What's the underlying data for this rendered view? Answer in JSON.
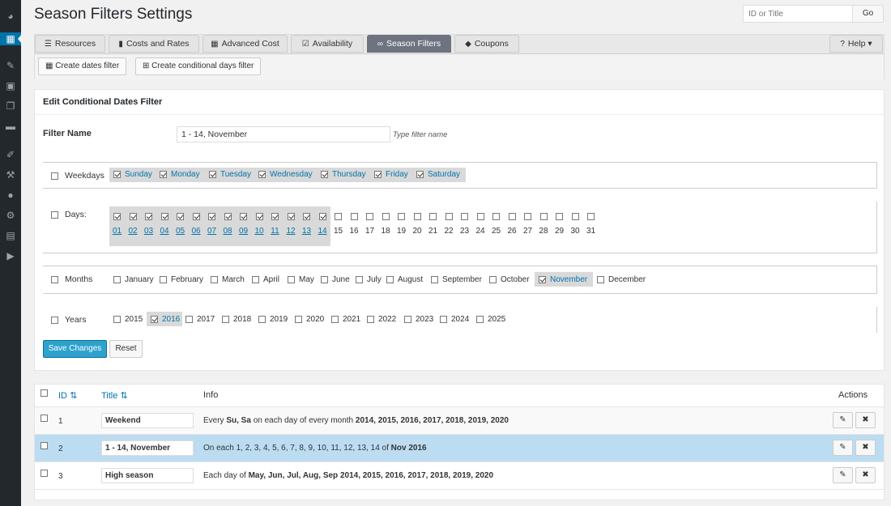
{
  "page": {
    "title": "Season Filters Settings"
  },
  "search": {
    "placeholder": "ID or Title",
    "go_label": "Go"
  },
  "tabs": [
    {
      "label": "Resources",
      "icon": "list-icon"
    },
    {
      "label": "Costs and Rates",
      "icon": "bar-chart-icon"
    },
    {
      "label": "Advanced Cost",
      "icon": "calculator-icon"
    },
    {
      "label": "Availability",
      "icon": "check-square-icon"
    },
    {
      "label": "Season Filters",
      "icon": "link-icon"
    },
    {
      "label": "Coupons",
      "icon": "tag-icon"
    }
  ],
  "help": {
    "label": "Help"
  },
  "subactions": {
    "create_dates": "Create dates filter",
    "create_conditional": "Create conditional days filter"
  },
  "panel": {
    "title": "Edit Conditional Dates Filter",
    "filter_name_label": "Filter Name",
    "filter_name_value": "1 - 14, November",
    "filter_name_hint": "Type filter name"
  },
  "weekdays": {
    "label": "Weekdays",
    "items": [
      "Sunday",
      "Monday",
      "Tuesday",
      "Wednesday",
      "Thursday",
      "Friday",
      "Saturday"
    ]
  },
  "days": {
    "label": "Days:",
    "items": [
      "01",
      "02",
      "03",
      "04",
      "05",
      "06",
      "07",
      "08",
      "09",
      "10",
      "11",
      "12",
      "13",
      "14",
      "15",
      "16",
      "17",
      "18",
      "19",
      "20",
      "21",
      "22",
      "23",
      "24",
      "25",
      "26",
      "27",
      "28",
      "29",
      "30",
      "31"
    ],
    "selected_count": 14
  },
  "months": {
    "label": "Months",
    "items": [
      "January",
      "February",
      "March",
      "April",
      "May",
      "June",
      "July",
      "August",
      "September",
      "October",
      "November",
      "December"
    ],
    "selected": "November"
  },
  "years": {
    "label": "Years",
    "items": [
      "2015",
      "2016",
      "2017",
      "2018",
      "2019",
      "2020",
      "2021",
      "2022",
      "2023",
      "2024",
      "2025"
    ],
    "selected": "2016"
  },
  "buttons": {
    "save": "Save Changes",
    "reset": "Reset"
  },
  "table": {
    "headers": {
      "id": "ID",
      "title": "Title",
      "info": "Info",
      "actions": "Actions"
    },
    "rows": [
      {
        "id": "1",
        "title": "Weekend",
        "info_parts": [
          [
            "Every ",
            false
          ],
          [
            "Su, Sa",
            true
          ],
          [
            " on each day of every month ",
            false
          ],
          [
            "2014, 2015, 2016, 2017, 2018, 2019, 2020",
            true
          ]
        ]
      },
      {
        "id": "2",
        "title": "1 - 14, November",
        "info_parts": [
          [
            "On each ",
            false
          ],
          [
            "1, 2, 3, 4, 5, 6, 7, 8, 9, 10, 11, 12, 13, 14",
            false
          ],
          [
            " of ",
            false
          ],
          [
            "Nov 2016",
            true
          ]
        ]
      },
      {
        "id": "3",
        "title": "High season",
        "info_parts": [
          [
            "Each day of ",
            false
          ],
          [
            "May, Jun, Jul, Aug, Sep 2014, 2015, 2016, 2017, 2018, 2019, 2020",
            true
          ]
        ]
      }
    ]
  },
  "colors": {
    "accent": "#0073aa",
    "sidebar": "#23282d",
    "active_tab": "#6d7480",
    "selected_row": "#bcdcf2",
    "save_button": "#2ea2cc"
  }
}
